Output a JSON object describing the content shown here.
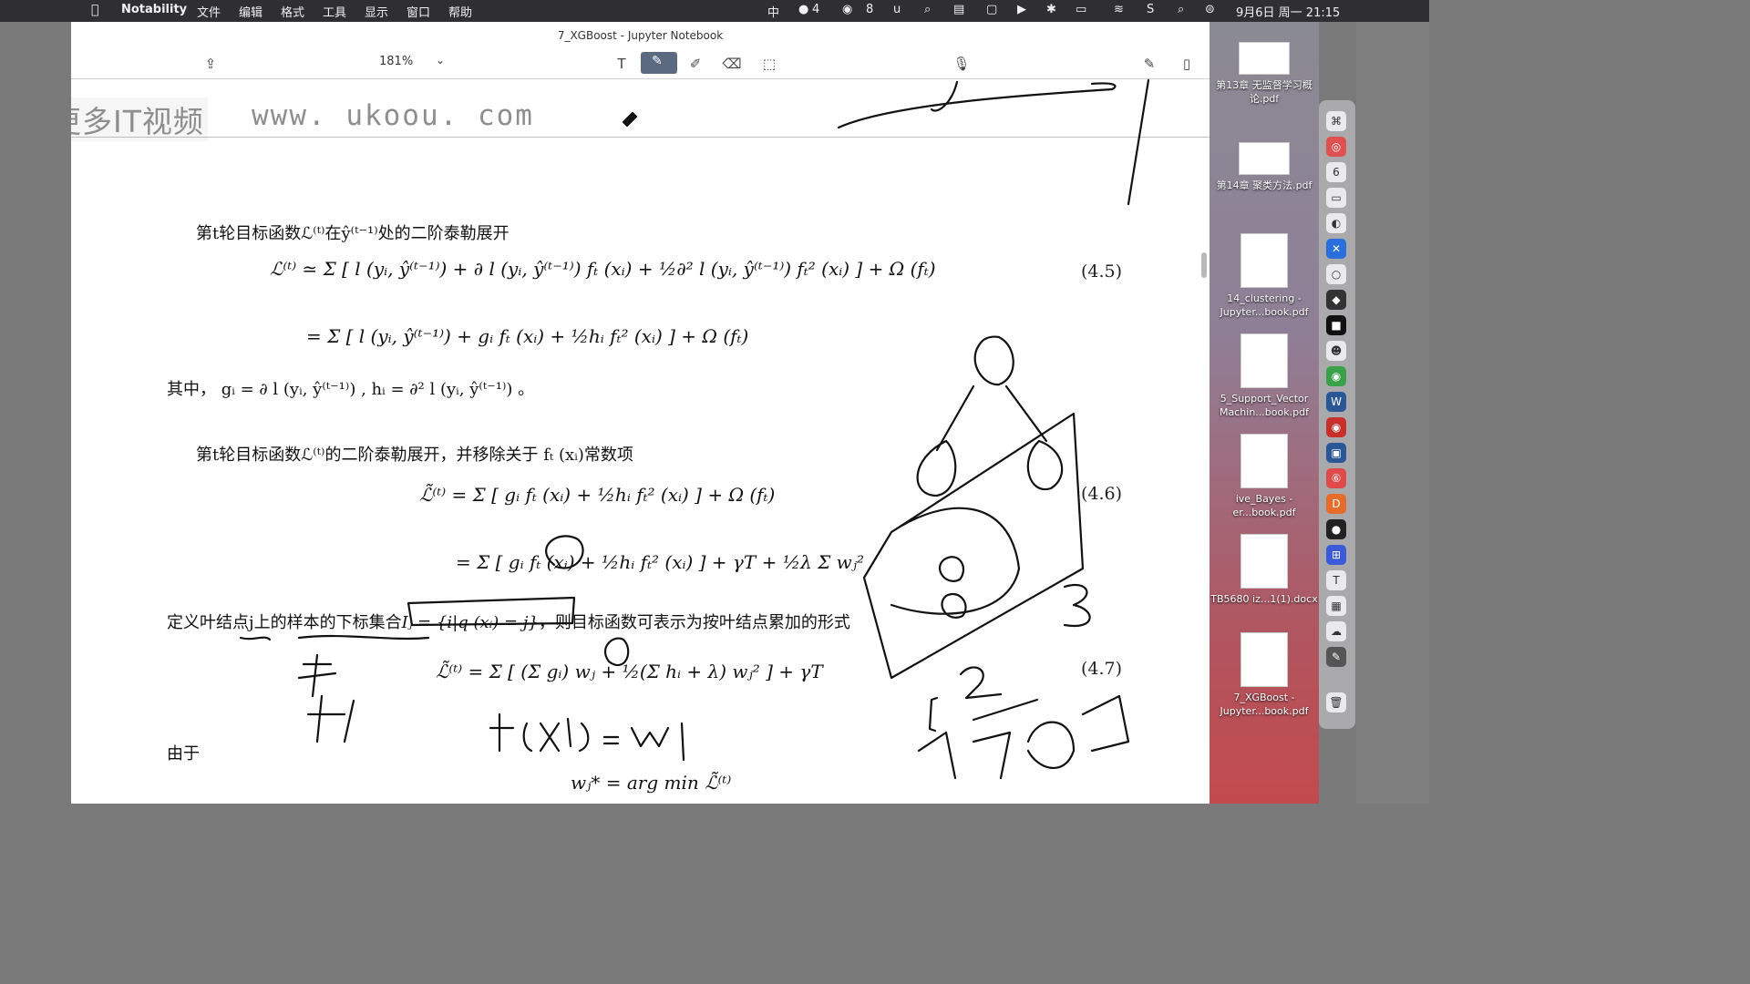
{
  "menubar": {
    "apple": "",
    "app": "Notability",
    "items": [
      "文件",
      "编辑",
      "格式",
      "工具",
      "显示",
      "窗口",
      "帮助"
    ],
    "status": {
      "input": "中",
      "badge1": "4",
      "badge2": "8",
      "datetime": "9月6日 周一  21:15"
    }
  },
  "window": {
    "title": "7_XGBoost - Jupyter Notebook",
    "zoom": "181%"
  },
  "watermark": {
    "cn": "更多IT视频",
    "url": "www. ukoou. com"
  },
  "content": {
    "l1": "第t轮目标函数ℒ⁽ᵗ⁾在ŷ⁽ᵗ⁻¹⁾处的二阶泰勒展开",
    "eq45a": "ℒ⁽ᵗ⁾ ≃ Σ [ l (yᵢ, ŷ⁽ᵗ⁻¹⁾) + ∂ l (yᵢ, ŷ⁽ᵗ⁻¹⁾) fₜ (xᵢ) + ½∂² l (yᵢ, ŷ⁽ᵗ⁻¹⁾) fₜ² (xᵢ) ] + Ω (fₜ)",
    "eq45_num": "(4.5)",
    "eq45b": "= Σ [ l (yᵢ, ŷ⁽ᵗ⁻¹⁾) + gᵢ fₜ (xᵢ) + ½hᵢ fₜ² (xᵢ) ] + Ω (fₜ)",
    "l2": "其中， gᵢ = ∂ l (yᵢ, ŷ⁽ᵗ⁻¹⁾) , hᵢ = ∂² l (yᵢ, ŷ⁽ᵗ⁻¹⁾) 。",
    "l3": "第t轮目标函数ℒ⁽ᵗ⁾的二阶泰勒展开，并移除关于 fₜ (xᵢ)常数项",
    "eq46a": "ℒ̃⁽ᵗ⁾ = Σ [ gᵢ fₜ (xᵢ) + ½hᵢ fₜ² (xᵢ) ] + Ω (fₜ)",
    "eq46_num": "(4.6)",
    "eq46b": "= Σ [ gᵢ fₜ (xᵢ) + ½hᵢ fₜ² (xᵢ) ] + γT + ½λ Σ wⱼ²",
    "l4a": "定义叶结点j上的样本的下标集合",
    "l4b": "Iⱼ = {i|q (xᵢ) = j}",
    "l4c": "，则目标函数可表示为按叶结点累加的形式",
    "eq47": "ℒ̃⁽ᵗ⁾ = Σ [ (Σ gᵢ) wⱼ + ½(Σ hᵢ + λ) wⱼ² ] + γT",
    "eq47_num": "(4.7)",
    "l5": "由于",
    "eq_last": "wⱼ* = arg min ℒ̃⁽ᵗ⁾"
  },
  "files": [
    {
      "name": "第13章 无监督学习概论.pdf"
    },
    {
      "name": "第14章 聚类方法.pdf"
    },
    {
      "name": "14_clustering - Jupyter...book.pdf"
    },
    {
      "name": "5_Support_Vector Machin...book.pdf"
    },
    {
      "name": "ive_Bayes - er...book.pdf"
    },
    {
      "name": "TB5680 iz...1(1).docx"
    },
    {
      "name": "7_XGBoost - Jupyter...book.pdf"
    }
  ],
  "dock_badge": "6"
}
